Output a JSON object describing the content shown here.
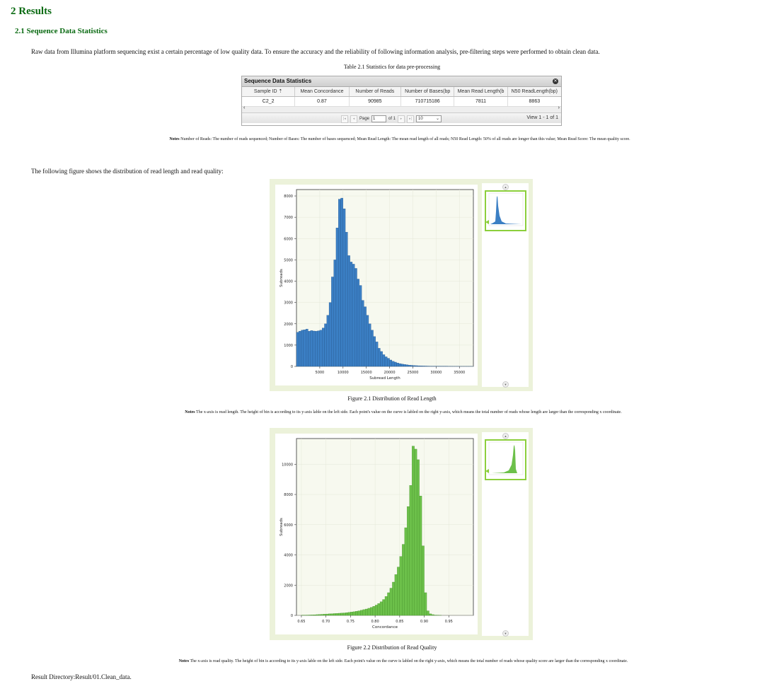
{
  "section_title": "2 Results",
  "subsection_title": "2.1 Sequence Data Statistics",
  "intro_text": "Raw data from Illumina platform sequencing exist a certain percentage of low quality data. To ensure the accuracy and the reliability of following information analysis, pre-filtering steps were performed to obtain clean data.",
  "table_caption": "Table 2.1 Statistics for data pre-processing",
  "grid": {
    "title": "Sequence Data Statistics",
    "columns": [
      "Sample ID",
      "Mean Concordance",
      "Number of Reads",
      "Number of Bases(bp",
      "Mean Read Length(b",
      "N50 ReadLength(bp)"
    ],
    "rows": [
      [
        "C2_2",
        "0.87",
        "90985",
        "710715186",
        "7811",
        "8863"
      ]
    ],
    "page_label": "Page",
    "page_value": "1",
    "of_label": "of 1",
    "per_page": "10",
    "view_text": "View 1 - 1 of 1"
  },
  "table_notes_label": "Notes",
  "table_notes": "Number of Reads: The number of reads sequenced; Number of Bases: The number of bases sequenced; Mean Read Length: The mean read length of all reads; N50 Read Length: 50% of all reads are longer than this value; Mean Read Score: The mean quality score.",
  "figure_intro": "The following figure shows the distribution of read length and read quality:",
  "figure1_caption": "Figure 2.1 Distribution of Read Length",
  "figure1_notes_label": "Notes",
  "figure1_notes": "The x-axis is read length. The height of bin is according to its y-axis lable on the left side. Each point's value on the curve is labled on the right y-axis, which means the total number of reads whose length are larger than the corresponding x coordinate.",
  "figure2_caption": "Figure 2.2 Distribution of Read Quality",
  "figure2_notes_label": "Notes",
  "figure2_notes": "The x-axis is read quality. The height of bin is according to its y-axis lable on the left side. Each point's value on the curve is labled on the right y-axis, which means the total number of reads whose quality score are larger than the corresponding x coordinate.",
  "result_dir": "Result Directory:Result/01.Clean_data.",
  "colors": {
    "heading": "#0a6a12",
    "bar_blue": "#3b7fc4",
    "bar_green": "#6cc04a",
    "frame": "#ecf2da",
    "thumb_border": "#8ccf3c"
  },
  "chart_data": [
    {
      "type": "bar",
      "xlabel": "Subread Length",
      "ylabel": "Subreads",
      "xlim": [
        0,
        38000
      ],
      "ylim": [
        0,
        8300
      ],
      "xticks": [
        5000,
        10000,
        15000,
        20000,
        25000,
        30000,
        35000
      ],
      "yticks": [
        0,
        1000,
        2000,
        3000,
        4000,
        5000,
        6000,
        7000,
        8000
      ],
      "bin_width": 500,
      "bin_start": 0,
      "values": [
        1600,
        1650,
        1700,
        1720,
        1750,
        1650,
        1680,
        1660,
        1650,
        1670,
        1700,
        1800,
        2000,
        2400,
        3000,
        4200,
        5000,
        6500,
        7850,
        7900,
        7400,
        6300,
        5200,
        4900,
        4800,
        4600,
        4100,
        3800,
        3100,
        2800,
        2400,
        2000,
        1700,
        1400,
        1150,
        850,
        700,
        550,
        450,
        380,
        300,
        240,
        200,
        160,
        130,
        110,
        90,
        75,
        60,
        50,
        40,
        35,
        30,
        25,
        20,
        18,
        15,
        12,
        10,
        9,
        8,
        7,
        6,
        5,
        5,
        4,
        4,
        3,
        3,
        3,
        2,
        2,
        2,
        2,
        2,
        1
      ]
    },
    {
      "type": "bar",
      "xlabel": "Concordance",
      "ylabel": "Subreads",
      "xlim": [
        0.64,
        1.0
      ],
      "ylim": [
        0,
        11700
      ],
      "xticks": [
        0.65,
        0.7,
        0.75,
        0.8,
        0.85,
        0.9,
        0.95
      ],
      "yticks": [
        0,
        2000,
        4000,
        6000,
        8000,
        10000
      ],
      "bin_width": 0.005,
      "bin_start": 0.65,
      "values": [
        10,
        15,
        20,
        25,
        30,
        40,
        50,
        60,
        70,
        80,
        90,
        100,
        110,
        120,
        130,
        140,
        150,
        160,
        180,
        200,
        220,
        240,
        270,
        300,
        340,
        380,
        420,
        470,
        530,
        600,
        680,
        780,
        900,
        1050,
        1250,
        1500,
        1800,
        2200,
        2700,
        3200,
        3900,
        4700,
        5800,
        7200,
        8600,
        11200,
        11000,
        10300,
        7900,
        4600,
        1500,
        300,
        100,
        50,
        20,
        10,
        5
      ]
    }
  ]
}
